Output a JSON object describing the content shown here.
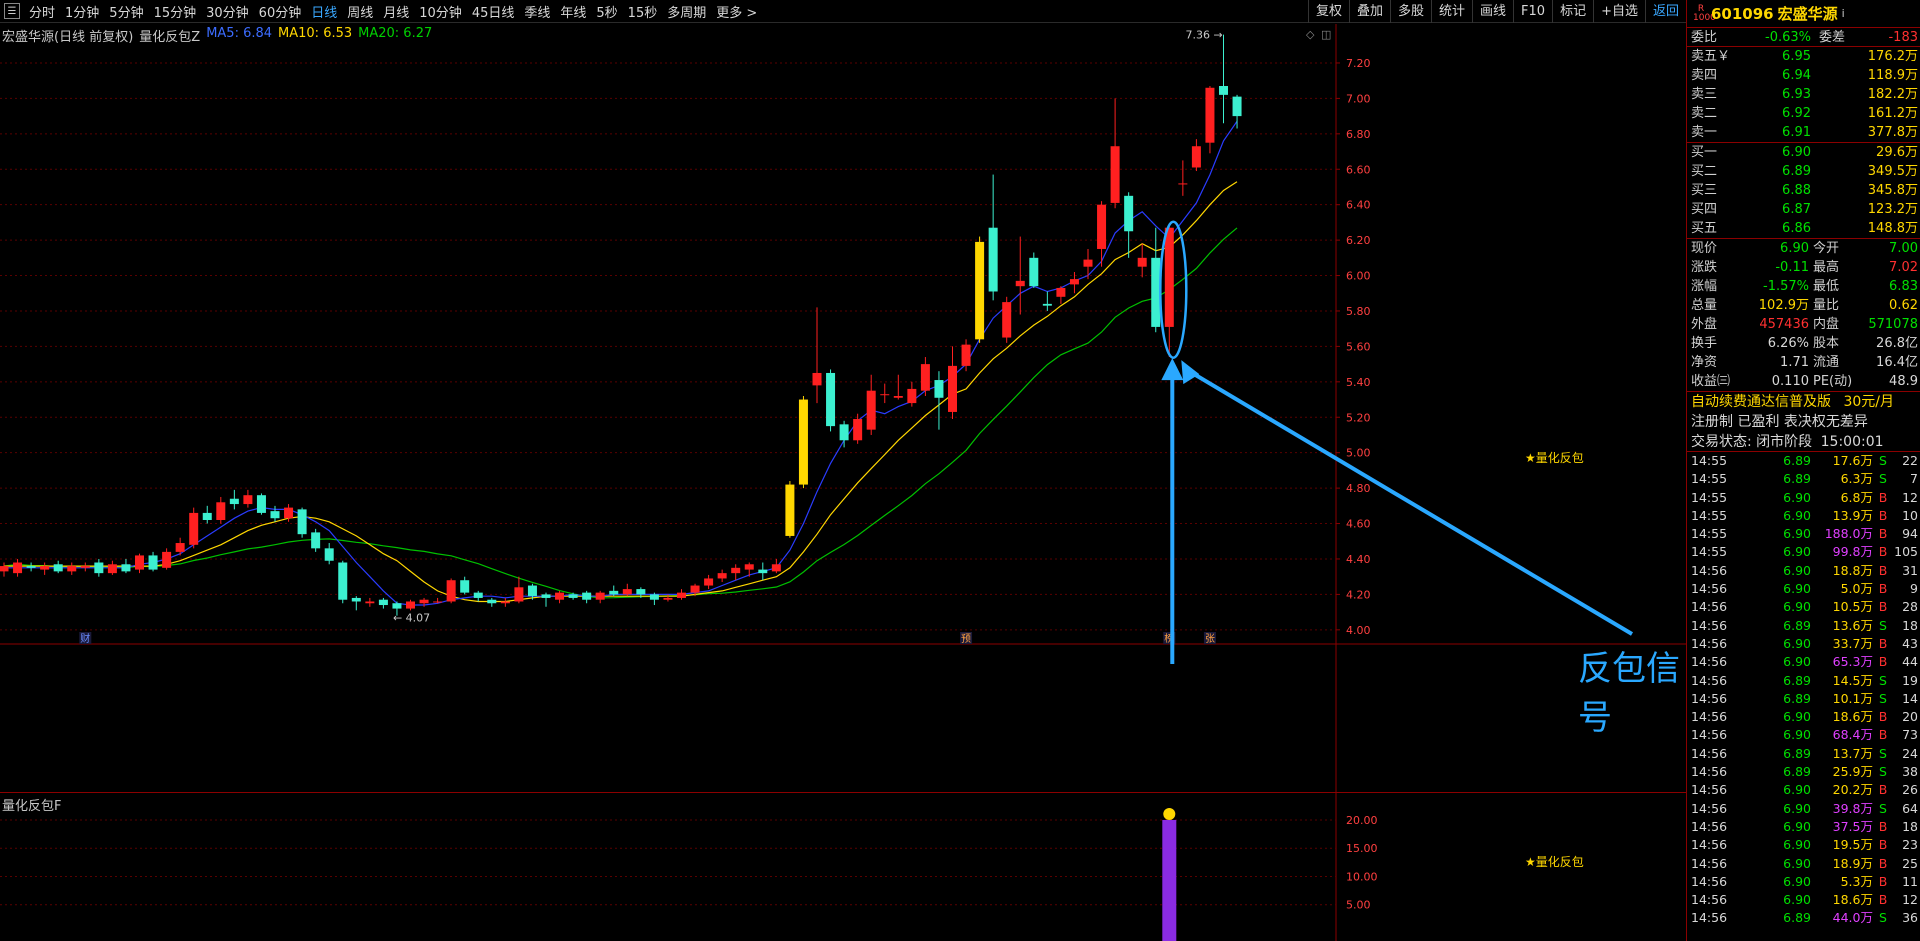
{
  "toolbar": {
    "periods": [
      "分时",
      "1分钟",
      "5分钟",
      "15分钟",
      "30分钟",
      "60分钟",
      "日线",
      "周线",
      "月线",
      "10分钟",
      "45日线",
      "季线",
      "年线",
      "5秒",
      "15秒",
      "多周期",
      "更多 >"
    ],
    "active_period": "日线",
    "tools": [
      "复权",
      "叠加",
      "多股",
      "统计",
      "画线",
      "F10",
      "标记",
      "+自选",
      "返回"
    ]
  },
  "legend": {
    "title": "宏盛华源(日线 前复权)",
    "indicator": "量化反包Z",
    "ma5": "MA5: 6.84",
    "ma10": "MA10: 6.53",
    "ma20": "MA20: 6.27"
  },
  "sub_legend": "量化反包F",
  "annotation": {
    "text": "反包信号",
    "signal": "★量化反包",
    "high_label": "7.36",
    "low_label": "4.07"
  },
  "colors": {
    "up": "#ff2020",
    "down": "#3cf0d0",
    "ma5": "#2a3cff",
    "ma10": "#ffd700",
    "ma20": "#00c000",
    "accent": "#2aa8ff",
    "signal_bar": "#8a2be2"
  },
  "markers": [
    "财",
    "预",
    "榜",
    "张"
  ],
  "chart_data": [
    {
      "type": "candlestick",
      "title": "宏盛华源(日线 前复权)",
      "y_ticks": [
        4.0,
        4.2,
        4.4,
        4.6,
        4.8,
        5.0,
        5.2,
        5.4,
        5.6,
        5.8,
        6.0,
        6.2,
        6.4,
        6.6,
        6.8,
        7.0,
        7.2
      ],
      "ylim": [
        3.92,
        7.42
      ],
      "candles": [
        [
          4.33,
          4.36,
          4.3,
          4.38
        ],
        [
          4.32,
          4.38,
          4.3,
          4.4
        ],
        [
          4.36,
          4.35,
          4.33,
          4.38
        ],
        [
          4.34,
          4.36,
          4.31,
          4.38
        ],
        [
          4.37,
          4.33,
          4.32,
          4.39
        ],
        [
          4.33,
          4.36,
          4.31,
          4.38
        ],
        [
          4.35,
          4.36,
          4.33,
          4.38
        ],
        [
          4.38,
          4.32,
          4.3,
          4.4
        ],
        [
          4.32,
          4.37,
          4.31,
          4.39
        ],
        [
          4.37,
          4.33,
          4.32,
          4.4
        ],
        [
          4.34,
          4.42,
          4.32,
          4.43
        ],
        [
          4.42,
          4.34,
          4.33,
          4.44
        ],
        [
          4.35,
          4.44,
          4.34,
          4.46
        ],
        [
          4.44,
          4.49,
          4.42,
          4.52
        ],
        [
          4.48,
          4.66,
          4.46,
          4.69
        ],
        [
          4.66,
          4.62,
          4.6,
          4.7
        ],
        [
          4.62,
          4.72,
          4.6,
          4.75
        ],
        [
          4.74,
          4.71,
          4.68,
          4.79
        ],
        [
          4.71,
          4.76,
          4.69,
          4.79
        ],
        [
          4.76,
          4.66,
          4.65,
          4.77
        ],
        [
          4.67,
          4.63,
          4.61,
          4.7
        ],
        [
          4.63,
          4.69,
          4.61,
          4.71
        ],
        [
          4.68,
          4.54,
          4.52,
          4.69
        ],
        [
          4.55,
          4.46,
          4.44,
          4.57
        ],
        [
          4.46,
          4.39,
          4.37,
          4.49
        ],
        [
          4.38,
          4.17,
          4.15,
          4.39
        ],
        [
          4.18,
          4.16,
          4.11,
          4.19
        ],
        [
          4.15,
          4.16,
          4.13,
          4.18
        ],
        [
          4.17,
          4.14,
          4.12,
          4.18
        ],
        [
          4.15,
          4.12,
          4.08,
          4.16
        ],
        [
          4.12,
          4.16,
          4.11,
          4.17
        ],
        [
          4.15,
          4.17,
          4.13,
          4.18
        ],
        [
          4.16,
          4.16,
          4.15,
          4.18
        ],
        [
          4.16,
          4.28,
          4.15,
          4.29
        ],
        [
          4.28,
          4.21,
          4.2,
          4.3
        ],
        [
          4.21,
          4.18,
          4.16,
          4.22
        ],
        [
          4.17,
          4.15,
          4.13,
          4.18
        ],
        [
          4.15,
          4.16,
          4.13,
          4.18
        ],
        [
          4.16,
          4.24,
          4.15,
          4.3
        ],
        [
          4.25,
          4.19,
          4.17,
          4.26
        ],
        [
          4.2,
          4.18,
          4.13,
          4.21
        ],
        [
          4.17,
          4.21,
          4.15,
          4.22
        ],
        [
          4.2,
          4.18,
          4.17,
          4.21
        ],
        [
          4.21,
          4.17,
          4.15,
          4.22
        ],
        [
          4.17,
          4.21,
          4.15,
          4.22
        ],
        [
          4.22,
          4.2,
          4.19,
          4.25
        ],
        [
          4.2,
          4.23,
          4.19,
          4.26
        ],
        [
          4.23,
          4.2,
          4.18,
          4.24
        ],
        [
          4.2,
          4.17,
          4.14,
          4.21
        ],
        [
          4.17,
          4.18,
          4.16,
          4.2
        ],
        [
          4.18,
          4.21,
          4.17,
          4.23
        ],
        [
          4.21,
          4.25,
          4.19,
          4.26
        ],
        [
          4.25,
          4.29,
          4.23,
          4.31
        ],
        [
          4.29,
          4.32,
          4.27,
          4.34
        ],
        [
          4.32,
          4.35,
          4.28,
          4.37
        ],
        [
          4.34,
          4.37,
          4.3,
          4.38
        ],
        [
          4.34,
          4.32,
          4.28,
          4.38
        ],
        [
          4.33,
          4.37,
          4.32,
          4.4
        ],
        [
          4.53,
          4.82,
          4.52,
          4.84
        ],
        [
          4.82,
          5.3,
          4.8,
          5.32
        ],
        [
          5.38,
          5.45,
          5.28,
          5.82
        ],
        [
          5.45,
          5.15,
          5.12,
          5.47
        ],
        [
          5.16,
          5.07,
          5.03,
          5.18
        ],
        [
          5.07,
          5.19,
          5.05,
          5.22
        ],
        [
          5.13,
          5.35,
          5.1,
          5.44
        ],
        [
          5.33,
          5.33,
          5.28,
          5.39
        ],
        [
          5.31,
          5.32,
          5.3,
          5.44
        ],
        [
          5.28,
          5.36,
          5.26,
          5.4
        ],
        [
          5.35,
          5.5,
          5.32,
          5.54
        ],
        [
          5.41,
          5.31,
          5.13,
          5.46
        ],
        [
          5.23,
          5.49,
          5.19,
          5.6
        ],
        [
          5.49,
          5.61,
          5.46,
          5.64
        ],
        [
          5.64,
          6.19,
          5.62,
          6.22
        ],
        [
          6.27,
          5.91,
          5.86,
          6.57
        ],
        [
          5.65,
          5.85,
          5.62,
          5.88
        ],
        [
          5.94,
          5.97,
          5.78,
          6.22
        ],
        [
          6.1,
          5.94,
          5.93,
          6.13
        ],
        [
          5.84,
          5.83,
          5.8,
          5.91
        ],
        [
          5.88,
          5.93,
          5.84,
          5.94
        ],
        [
          5.95,
          5.98,
          5.9,
          6.02
        ],
        [
          6.05,
          6.09,
          5.98,
          6.15
        ],
        [
          6.15,
          6.4,
          6.05,
          6.42
        ],
        [
          6.41,
          6.73,
          6.38,
          7.0
        ],
        [
          6.45,
          6.25,
          6.1,
          6.47
        ],
        [
          6.05,
          6.1,
          5.99,
          6.18
        ],
        [
          6.1,
          5.71,
          5.68,
          6.27
        ],
        [
          5.71,
          6.27,
          5.54,
          6.28
        ],
        [
          6.52,
          6.52,
          6.45,
          6.65
        ],
        [
          6.61,
          6.73,
          6.59,
          6.77
        ],
        [
          6.75,
          7.06,
          6.69,
          7.07
        ],
        [
          7.07,
          7.02,
          6.86,
          7.36
        ],
        [
          7.01,
          6.9,
          6.83,
          7.02
        ]
      ],
      "ma5": [
        4.35,
        4.35,
        4.35,
        4.35,
        4.35,
        4.35,
        4.35,
        4.35,
        4.35,
        4.35,
        4.37,
        4.38,
        4.4,
        4.43,
        4.48,
        4.53,
        4.58,
        4.63,
        4.67,
        4.69,
        4.68,
        4.68,
        4.65,
        4.61,
        4.56,
        4.47,
        4.38,
        4.3,
        4.22,
        4.15,
        4.14,
        4.14,
        4.15,
        4.17,
        4.18,
        4.19,
        4.19,
        4.18,
        4.19,
        4.19,
        4.19,
        4.19,
        4.2,
        4.19,
        4.19,
        4.2,
        4.2,
        4.2,
        4.2,
        4.2,
        4.2,
        4.21,
        4.22,
        4.25,
        4.28,
        4.31,
        4.33,
        4.35,
        4.45,
        4.6,
        4.78,
        4.94,
        5.07,
        5.18,
        5.24,
        5.22,
        5.26,
        5.29,
        5.35,
        5.38,
        5.43,
        5.5,
        5.64,
        5.76,
        5.83,
        5.9,
        5.94,
        5.91,
        5.93,
        5.97,
        6.0,
        6.08,
        6.24,
        6.31,
        6.36,
        6.28,
        6.21,
        6.31,
        6.41,
        6.57,
        6.76,
        6.87
      ],
      "ma10": [
        4.36,
        4.36,
        4.36,
        4.36,
        4.36,
        4.36,
        4.36,
        4.36,
        4.36,
        4.36,
        4.36,
        4.36,
        4.37,
        4.39,
        4.42,
        4.45,
        4.48,
        4.52,
        4.56,
        4.59,
        4.61,
        4.63,
        4.64,
        4.63,
        4.61,
        4.57,
        4.53,
        4.48,
        4.43,
        4.39,
        4.33,
        4.27,
        4.22,
        4.19,
        4.17,
        4.16,
        4.16,
        4.16,
        4.17,
        4.18,
        4.19,
        4.19,
        4.19,
        4.19,
        4.19,
        4.19,
        4.19,
        4.19,
        4.19,
        4.19,
        4.19,
        4.2,
        4.21,
        4.22,
        4.24,
        4.26,
        4.28,
        4.3,
        4.35,
        4.44,
        4.54,
        4.65,
        4.74,
        4.83,
        4.91,
        4.99,
        5.07,
        5.14,
        5.21,
        5.27,
        5.33,
        5.36,
        5.45,
        5.53,
        5.59,
        5.66,
        5.72,
        5.77,
        5.83,
        5.88,
        5.95,
        6.01,
        6.09,
        6.13,
        6.18,
        6.14,
        6.16,
        6.23,
        6.31,
        6.4,
        6.48,
        6.53
      ]
    },
    {
      "type": "bar",
      "title": "量化反包F",
      "y_ticks": [
        5.0,
        10.0,
        15.0,
        20.0
      ],
      "ylim": [
        0,
        23
      ],
      "signal_index": 86,
      "signal_value": 20
    }
  ],
  "quote": {
    "badge": "R\n1000",
    "code": "601096",
    "name": "宏盛华源",
    "wei_bi_label": "委比",
    "wei_bi": "-0.63%",
    "wei_cha_label": "委差",
    "wei_cha": "-183",
    "asks": [
      {
        "label": "卖五￥",
        "price": "6.95",
        "vol": "176.2万"
      },
      {
        "label": "卖四",
        "price": "6.94",
        "vol": "118.9万"
      },
      {
        "label": "卖三",
        "price": "6.93",
        "vol": "182.2万"
      },
      {
        "label": "卖二",
        "price": "6.92",
        "vol": "161.2万"
      },
      {
        "label": "卖一",
        "price": "6.91",
        "vol": "377.8万"
      }
    ],
    "bids": [
      {
        "label": "买一",
        "price": "6.90",
        "vol": "29.6万"
      },
      {
        "label": "买二",
        "price": "6.89",
        "vol": "349.5万"
      },
      {
        "label": "买三",
        "price": "6.88",
        "vol": "345.8万"
      },
      {
        "label": "买四",
        "price": "6.87",
        "vol": "123.2万"
      },
      {
        "label": "买五",
        "price": "6.86",
        "vol": "148.8万"
      }
    ],
    "info": [
      [
        {
          "t": "现价",
          "c": "white"
        },
        {
          "t": "6.90",
          "c": "green"
        },
        {
          "t": "今开",
          "c": "white"
        },
        {
          "t": "7.00",
          "c": "green"
        }
      ],
      [
        {
          "t": "涨跌",
          "c": "white"
        },
        {
          "t": "-0.11",
          "c": "green"
        },
        {
          "t": "最高",
          "c": "white"
        },
        {
          "t": "7.02",
          "c": "red"
        }
      ],
      [
        {
          "t": "涨幅",
          "c": "white"
        },
        {
          "t": "-1.57%",
          "c": "green"
        },
        {
          "t": "最低",
          "c": "white"
        },
        {
          "t": "6.83",
          "c": "green"
        }
      ],
      [
        {
          "t": "总量",
          "c": "white"
        },
        {
          "t": "102.9万",
          "c": "yellow"
        },
        {
          "t": "量比",
          "c": "white"
        },
        {
          "t": "0.62",
          "c": "yellow"
        }
      ],
      [
        {
          "t": "外盘",
          "c": "white"
        },
        {
          "t": "457436",
          "c": "red"
        },
        {
          "t": "内盘",
          "c": "white"
        },
        {
          "t": "571078",
          "c": "green"
        }
      ],
      [
        {
          "t": "换手",
          "c": "white"
        },
        {
          "t": "6.26%",
          "c": "white"
        },
        {
          "t": "股本",
          "c": "white"
        },
        {
          "t": "26.8亿",
          "c": "white"
        }
      ],
      [
        {
          "t": "净资",
          "c": "white"
        },
        {
          "t": "1.71",
          "c": "white"
        },
        {
          "t": "流通",
          "c": "white"
        },
        {
          "t": "16.4亿",
          "c": "white"
        }
      ],
      [
        {
          "t": "收益㈢",
          "c": "white"
        },
        {
          "t": "0.110",
          "c": "white"
        },
        {
          "t": "PE(动)",
          "c": "white"
        },
        {
          "t": "48.9",
          "c": "white"
        }
      ]
    ],
    "promo1": "自动续费通达信普及版",
    "promo1_price": "30元/月",
    "promo2": "注册制 已盈利 表决权无差异",
    "status_label": "交易状态: 闭市阶段",
    "status_time": "15:00:01"
  },
  "trades": [
    {
      "time": "14:55",
      "price": "6.89",
      "vol": "17.6万",
      "bs": "S",
      "n": "22",
      "pc": "green",
      "vc": "yellow"
    },
    {
      "time": "14:55",
      "price": "6.89",
      "vol": "6.3万",
      "bs": "S",
      "n": "7",
      "pc": "green",
      "vc": "yellow"
    },
    {
      "time": "14:55",
      "price": "6.90",
      "vol": "6.8万",
      "bs": "B",
      "n": "12",
      "pc": "green",
      "vc": "yellow"
    },
    {
      "time": "14:55",
      "price": "6.90",
      "vol": "13.9万",
      "bs": "B",
      "n": "10",
      "pc": "green",
      "vc": "yellow"
    },
    {
      "time": "14:55",
      "price": "6.90",
      "vol": "188.0万",
      "bs": "B",
      "n": "94",
      "pc": "green",
      "vc": "magenta"
    },
    {
      "time": "14:55",
      "price": "6.90",
      "vol": "99.8万",
      "bs": "B",
      "n": "105",
      "pc": "green",
      "vc": "magenta"
    },
    {
      "time": "14:56",
      "price": "6.90",
      "vol": "18.8万",
      "bs": "B",
      "n": "31",
      "pc": "green",
      "vc": "yellow"
    },
    {
      "time": "14:56",
      "price": "6.90",
      "vol": "5.0万",
      "bs": "B",
      "n": "9",
      "pc": "green",
      "vc": "yellow"
    },
    {
      "time": "14:56",
      "price": "6.90",
      "vol": "10.5万",
      "bs": "B",
      "n": "28",
      "pc": "green",
      "vc": "yellow"
    },
    {
      "time": "14:56",
      "price": "6.89",
      "vol": "13.6万",
      "bs": "S",
      "n": "18",
      "pc": "green",
      "vc": "yellow"
    },
    {
      "time": "14:56",
      "price": "6.90",
      "vol": "33.7万",
      "bs": "B",
      "n": "43",
      "pc": "green",
      "vc": "yellow"
    },
    {
      "time": "14:56",
      "price": "6.90",
      "vol": "65.3万",
      "bs": "B",
      "n": "44",
      "pc": "green",
      "vc": "magenta"
    },
    {
      "time": "14:56",
      "price": "6.89",
      "vol": "14.5万",
      "bs": "S",
      "n": "19",
      "pc": "green",
      "vc": "yellow"
    },
    {
      "time": "14:56",
      "price": "6.89",
      "vol": "10.1万",
      "bs": "S",
      "n": "14",
      "pc": "green",
      "vc": "yellow"
    },
    {
      "time": "14:56",
      "price": "6.90",
      "vol": "18.6万",
      "bs": "B",
      "n": "20",
      "pc": "green",
      "vc": "yellow"
    },
    {
      "time": "14:56",
      "price": "6.90",
      "vol": "68.4万",
      "bs": "B",
      "n": "73",
      "pc": "green",
      "vc": "magenta"
    },
    {
      "time": "14:56",
      "price": "6.89",
      "vol": "13.7万",
      "bs": "S",
      "n": "24",
      "pc": "green",
      "vc": "yellow"
    },
    {
      "time": "14:56",
      "price": "6.89",
      "vol": "25.9万",
      "bs": "S",
      "n": "38",
      "pc": "green",
      "vc": "yellow"
    },
    {
      "time": "14:56",
      "price": "6.90",
      "vol": "20.2万",
      "bs": "B",
      "n": "26",
      "pc": "green",
      "vc": "yellow"
    },
    {
      "time": "14:56",
      "price": "6.90",
      "vol": "39.8万",
      "bs": "S",
      "n": "64",
      "pc": "green",
      "vc": "magenta"
    },
    {
      "time": "14:56",
      "price": "6.90",
      "vol": "37.5万",
      "bs": "B",
      "n": "18",
      "pc": "green",
      "vc": "magenta"
    },
    {
      "time": "14:56",
      "price": "6.90",
      "vol": "19.5万",
      "bs": "B",
      "n": "23",
      "pc": "green",
      "vc": "yellow"
    },
    {
      "time": "14:56",
      "price": "6.90",
      "vol": "18.9万",
      "bs": "B",
      "n": "25",
      "pc": "green",
      "vc": "yellow"
    },
    {
      "time": "14:56",
      "price": "6.90",
      "vol": "5.3万",
      "bs": "B",
      "n": "11",
      "pc": "green",
      "vc": "yellow"
    },
    {
      "time": "14:56",
      "price": "6.90",
      "vol": "18.6万",
      "bs": "B",
      "n": "12",
      "pc": "green",
      "vc": "yellow"
    },
    {
      "time": "14:56",
      "price": "6.89",
      "vol": "44.0万",
      "bs": "S",
      "n": "36",
      "pc": "green",
      "vc": "magenta"
    }
  ]
}
